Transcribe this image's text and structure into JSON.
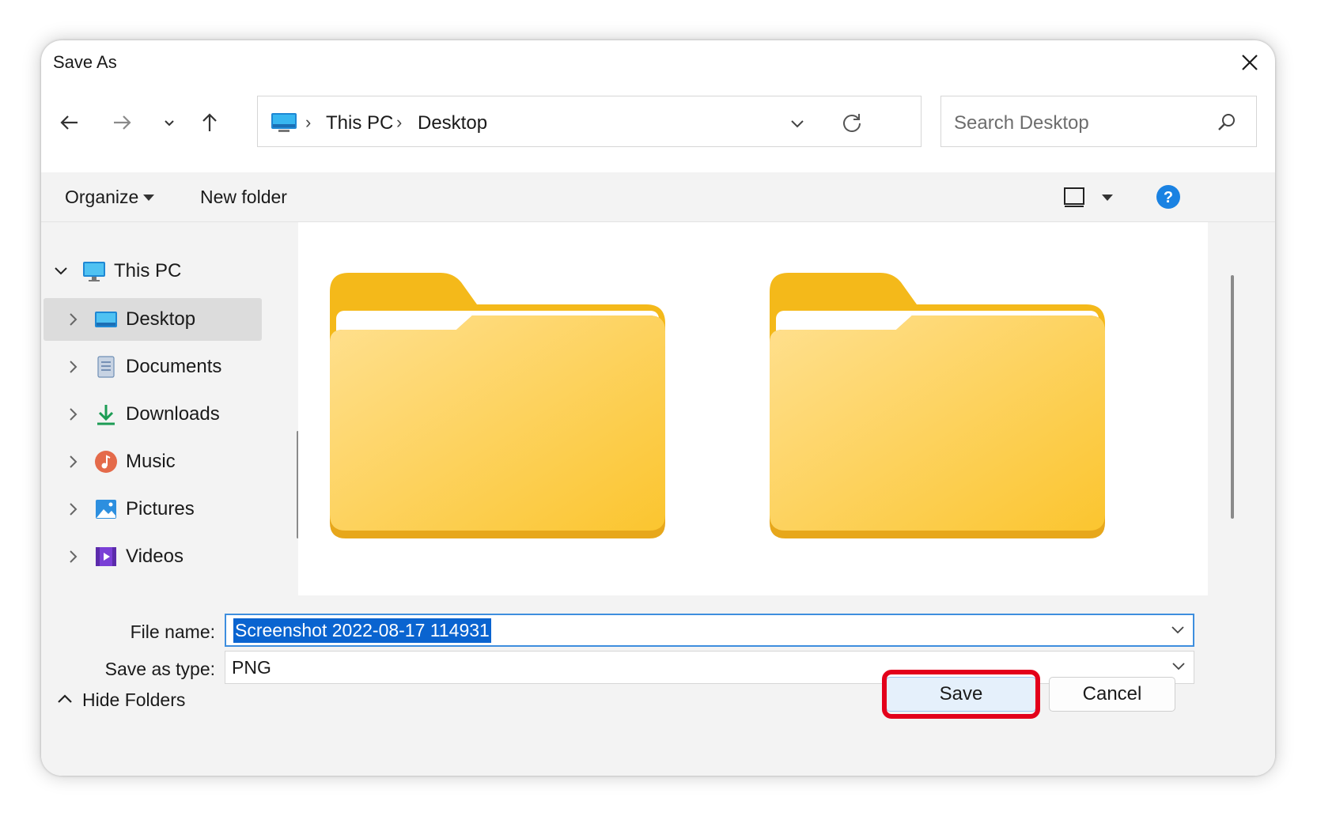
{
  "dialog": {
    "title": "Save As"
  },
  "nav": {
    "back": "back-arrow-icon",
    "forward": "forward-arrow-icon",
    "recent": "chevron-down-icon",
    "up": "up-arrow-icon"
  },
  "address": {
    "crumbs": [
      "This PC",
      "Desktop"
    ]
  },
  "search": {
    "placeholder": "Search Desktop"
  },
  "toolbar": {
    "organize": "Organize",
    "new_folder": "New folder"
  },
  "sidebar": {
    "root": "This PC",
    "items": [
      {
        "label": "Desktop",
        "selected": true
      },
      {
        "label": "Documents"
      },
      {
        "label": "Downloads"
      },
      {
        "label": "Music"
      },
      {
        "label": "Pictures"
      },
      {
        "label": "Videos"
      }
    ]
  },
  "content": {
    "folder_count": 2
  },
  "form": {
    "file_name_label": "File name:",
    "file_name_value": "Screenshot 2022-08-17 114931",
    "type_label": "Save as type:",
    "type_value": "PNG"
  },
  "footer": {
    "hide_folders": "Hide Folders",
    "save": "Save",
    "cancel": "Cancel"
  },
  "colors": {
    "accent": "#0a64d0",
    "highlight": "#e3001b",
    "folder": "#fbc12d"
  }
}
